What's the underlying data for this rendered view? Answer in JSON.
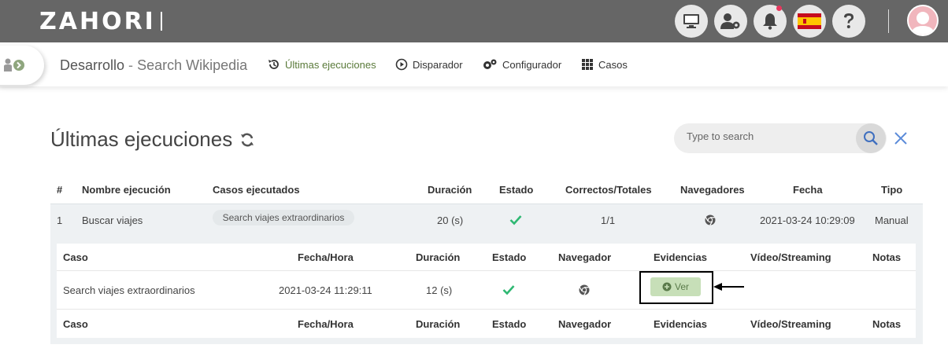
{
  "header": {
    "logo": "ZAHORI",
    "icons": [
      "monitor-icon",
      "user-gear-icon",
      "bell-icon",
      "spain-flag-icon",
      "help-icon"
    ]
  },
  "breadcrumb": {
    "environment": "Desarrollo",
    "separator": "-",
    "process": "Search Wikipedia"
  },
  "nav": [
    {
      "label": "Últimas ejecuciones",
      "icon": "history-icon",
      "active": true
    },
    {
      "label": "Disparador",
      "icon": "play-icon"
    },
    {
      "label": "Configurador",
      "icon": "gears-icon"
    },
    {
      "label": "Casos",
      "icon": "grid-icon"
    }
  ],
  "page": {
    "title": "Últimas ejecuciones",
    "search_placeholder": "Type to search"
  },
  "table": {
    "headers": [
      "#",
      "Nombre ejecución",
      "Casos ejecutados",
      "Duración",
      "Estado",
      "Correctos/Totales",
      "Navegadores",
      "Fecha",
      "Tipo"
    ],
    "rows": [
      {
        "num": "1",
        "name": "Buscar viajes",
        "cases": "Search viajes extraordinarios",
        "duration": "20 (s)",
        "status": "ok",
        "correct": "1/1",
        "browser": "chrome-icon",
        "date": "2021-03-24 10:29:09",
        "type": "Manual"
      }
    ]
  },
  "detail": {
    "headers": [
      "Caso",
      "Fecha/Hora",
      "Duración",
      "Estado",
      "Navegador",
      "Evidencias",
      "Vídeo/Streaming",
      "Notas"
    ],
    "rows": [
      {
        "case": "Search viajes extraordinarios",
        "datetime": "2021-03-24 11:29:11",
        "duration": "12 (s)",
        "status": "ok",
        "browser": "chrome-icon",
        "evidence_button": "Ver"
      }
    ]
  },
  "colors": {
    "topbar": "#666666",
    "success": "#2eb872",
    "active_nav": "#5a7a3a",
    "ver_button": "#c7dfb8"
  }
}
